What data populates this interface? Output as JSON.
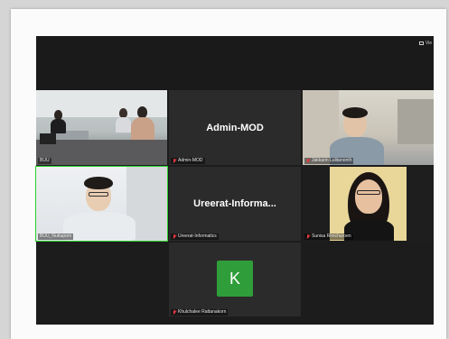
{
  "window": {
    "view_label": "Vie"
  },
  "tiles": [
    {
      "label": "BUU",
      "type": "video"
    },
    {
      "label": "Admin-MOD",
      "big_name": "Admin-MOD",
      "type": "name"
    },
    {
      "label": "Jakkarin Lulitanonth",
      "type": "video"
    },
    {
      "label": "BUU_Nuttaporn",
      "type": "video",
      "active": true
    },
    {
      "label": "Ureerat-Informatics",
      "big_name": "Ureerat-Informa...",
      "type": "name"
    },
    {
      "label": "Sunisa Rimcharoen",
      "type": "video"
    },
    {
      "label": "Khulchalee Rattanakorn",
      "avatar_letter": "K",
      "type": "avatar"
    }
  ],
  "colors": {
    "window_bg": "#1c1c1c",
    "tile_bg": "#2b2b2b",
    "active_speaker": "#2ad12a",
    "muted_icon": "#e0383e",
    "avatar_bg": "#2f9e3a"
  }
}
